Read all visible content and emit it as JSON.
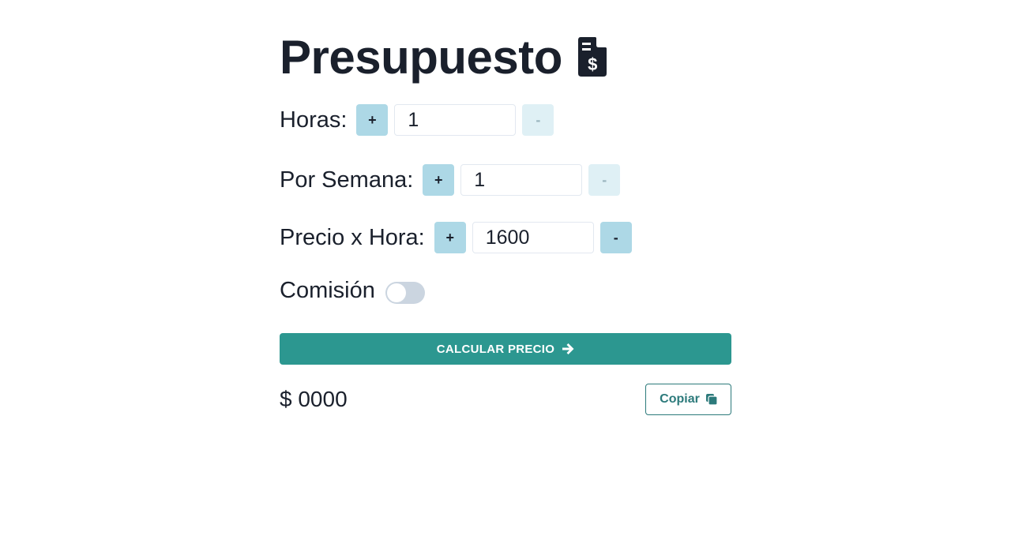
{
  "title": "Presupuesto",
  "title_icon": "file-invoice-dollar-icon",
  "fields": {
    "horas": {
      "label": "Horas:",
      "value": "1",
      "plus": "+",
      "minus": "-",
      "minus_disabled": true
    },
    "semana": {
      "label": "Por Semana:",
      "value": "1",
      "plus": "+",
      "minus": "-",
      "minus_disabled": true
    },
    "precio": {
      "label": "Precio x Hora:",
      "value": "1600",
      "plus": "+",
      "minus": "-",
      "minus_disabled": false
    }
  },
  "comision": {
    "label": "Comisión",
    "enabled": false
  },
  "calculate_button": {
    "label": "CALCULAR PRECIO",
    "icon": "arrow-right-icon"
  },
  "result": {
    "text": "$ 0000"
  },
  "copy_button": {
    "label": "Copiar",
    "icon": "copy-icon"
  },
  "colors": {
    "accent": "#2c9790",
    "stepper": "#add8e6",
    "stepper_disabled": "#dff0f5",
    "toggle_off": "#cbd5e0",
    "text": "#1a202c"
  }
}
